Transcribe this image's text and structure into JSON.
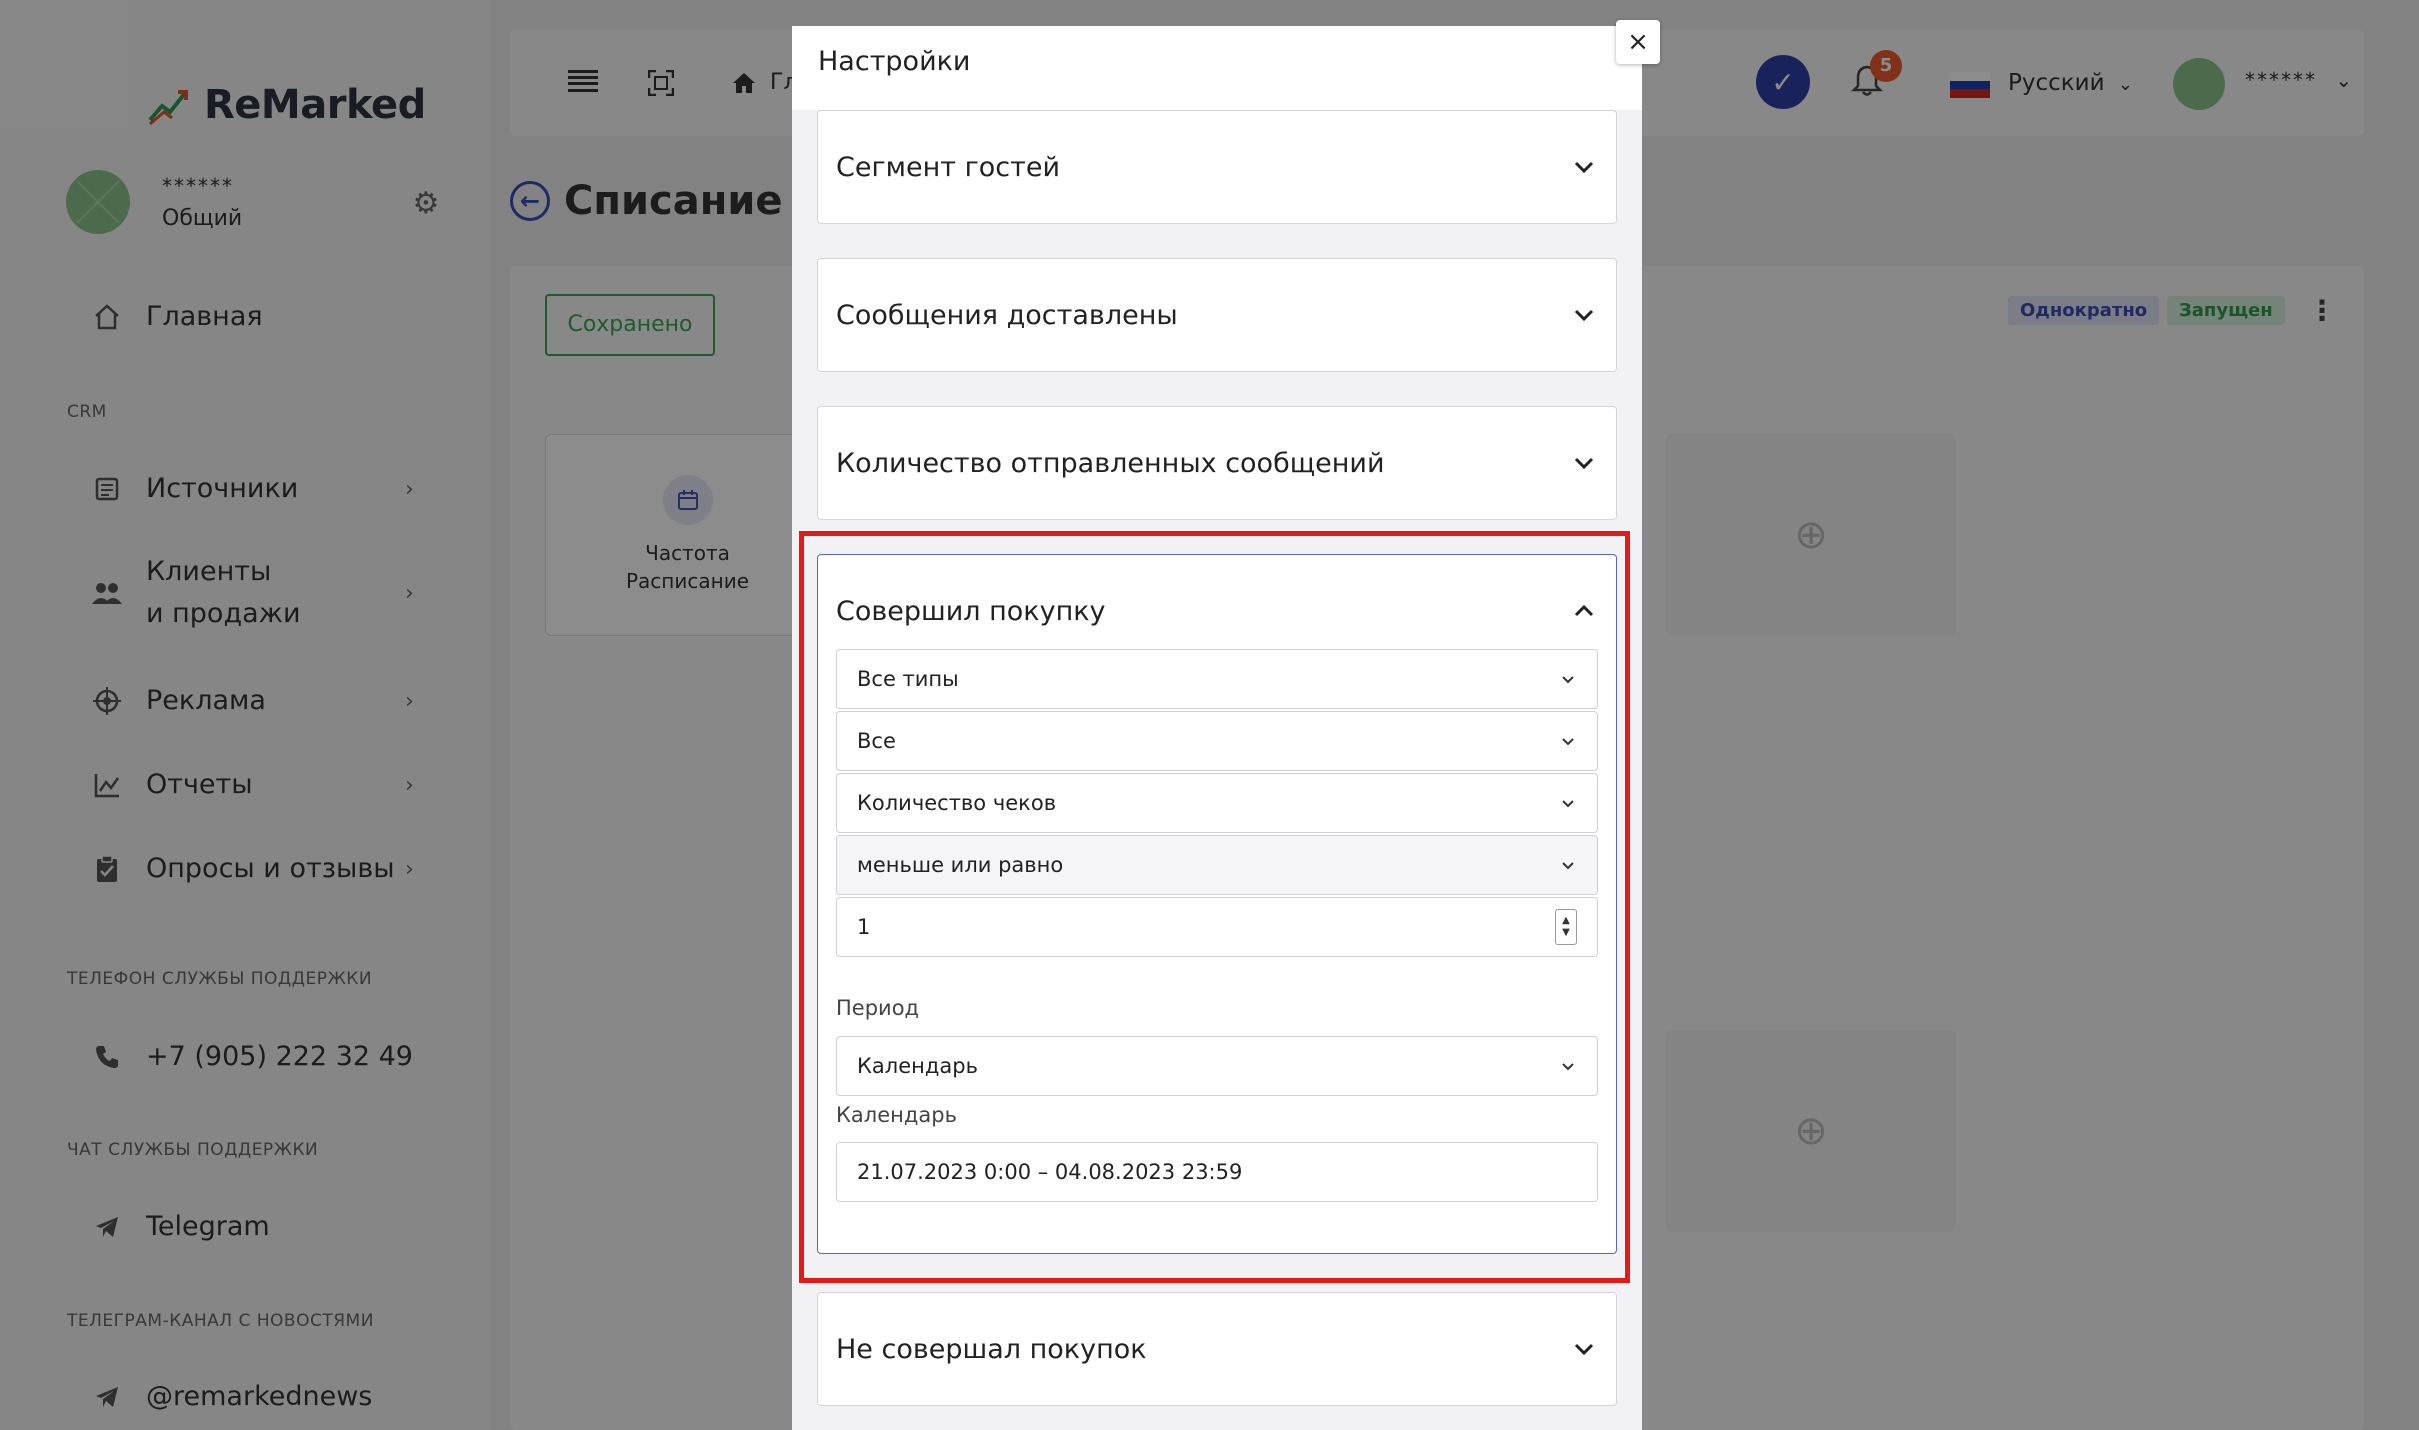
{
  "sidebar": {
    "logo_text": "ReMarked",
    "profile": {
      "name": "******",
      "role": "Общий"
    },
    "items": [
      {
        "label": "Главная",
        "icon": "home-icon"
      },
      {
        "label": "Источники",
        "icon": "sources-icon"
      },
      {
        "label": "Клиенты",
        "label2": "и продажи",
        "icon": "clients-icon"
      },
      {
        "label": "Реклама",
        "icon": "ads-icon"
      },
      {
        "label": "Отчеты",
        "icon": "reports-icon"
      },
      {
        "label": "Опросы и отзывы",
        "icon": "survey-icon"
      }
    ],
    "section_crm": "CRM",
    "support_phone_label": "ТЕЛЕФОН СЛУЖБЫ ПОДДЕРЖКИ",
    "support_phone": "+7 (905) 222 32 49",
    "support_chat_label": "ЧАТ СЛУЖБЫ ПОДДЕРЖКИ",
    "support_chat": "Telegram",
    "news_label": "ТЕЛЕГРАМ-КАНАЛ С НОВОСТЯМИ",
    "news_channel": "@remarkednews"
  },
  "topbar": {
    "breadcrumb_home": "Гл",
    "notifications_count": "5",
    "language": "Русский",
    "user_name": "******"
  },
  "page": {
    "title": "Списание бо",
    "saved_label": "Сохранено",
    "badge_once": "Однократно",
    "badge_running": "Запущен",
    "node_label_1": "Частота",
    "node_label_2": "Расписание"
  },
  "modal": {
    "title": "Настройки",
    "sections": [
      {
        "title": "Сегмент гостей"
      },
      {
        "title": "Сообщения доставлены"
      },
      {
        "title": "Количество отправленных сообщений"
      },
      {
        "title": "Совершил покупку"
      },
      {
        "title": "Не совершал покупок"
      }
    ],
    "purchase": {
      "type": "Все типы",
      "scope": "Все",
      "metric": "Количество чеков",
      "operator": "меньше или равно",
      "value": "1",
      "period_label": "Период",
      "period": "Календарь",
      "calendar_label": "Календарь",
      "date_range": "21.07.2023 0:00 – 04.08.2023 23:59"
    }
  },
  "colors": {
    "accent": "#3c4bb5",
    "success": "#3aa55a",
    "highlight": "#e21a1a",
    "badge": "#e9592b"
  }
}
